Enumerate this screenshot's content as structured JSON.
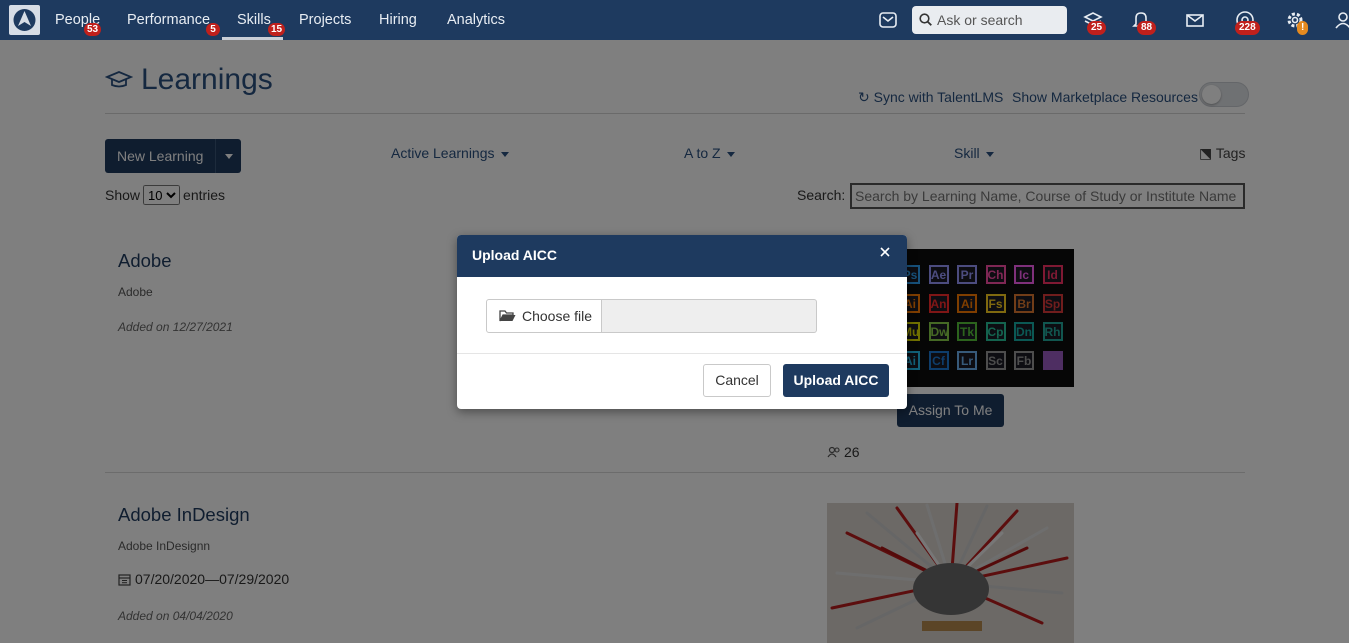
{
  "nav": {
    "items": [
      {
        "label": "People",
        "badge": "53"
      },
      {
        "label": "Performance",
        "badge": "5"
      },
      {
        "label": "Skills",
        "badge": "15"
      },
      {
        "label": "Projects"
      },
      {
        "label": "Hiring"
      },
      {
        "label": "Analytics"
      }
    ],
    "search_placeholder": "Ask or search",
    "badges": {
      "learning": "25",
      "notifications": "88",
      "help": "228",
      "settings": "!"
    }
  },
  "page": {
    "title": "Learnings",
    "sync_label": "Sync with TalentLMS",
    "marketplace_label": "Show Marketplace Resources",
    "new_button": "New Learning",
    "filters": {
      "status": "Active Learnings",
      "sort": "A to Z",
      "skill": "Skill",
      "tags": "Tags"
    },
    "show_label": "Show",
    "entries_value": "10",
    "entries_label": "entries",
    "search_label": "Search:",
    "search_placeholder": "Search by Learning Name, Course of Study or Institute Name"
  },
  "learnings": [
    {
      "title": "Adobe",
      "subtitle": "Adobe",
      "added": "Added on 12/27/2021",
      "assign_label": "Assign To Me",
      "count": "26",
      "tiles": [
        "Ps",
        "Ae",
        "Pr",
        "Ch",
        "Ic",
        "Id",
        "Ai",
        "An",
        "Ai",
        "Fs",
        "Br",
        "Sp",
        "Mu",
        "Dw",
        "Tk",
        "Cp",
        "Dn",
        "Rh",
        "Ai",
        "Cf",
        "Lr",
        "Sc",
        "Fb",
        ""
      ]
    },
    {
      "title": "Adobe InDesign",
      "subtitle": "Adobe InDesignn",
      "dates": "07/20/2020—07/29/2020",
      "added": "Added on 04/04/2020"
    }
  ],
  "modal": {
    "title": "Upload AICC",
    "choose_label": "Choose file",
    "cancel_label": "Cancel",
    "submit_label": "Upload AICC"
  },
  "colors": {
    "brand": "#1e3a5f",
    "badge": "#c0201c",
    "link": "#2a5180"
  }
}
